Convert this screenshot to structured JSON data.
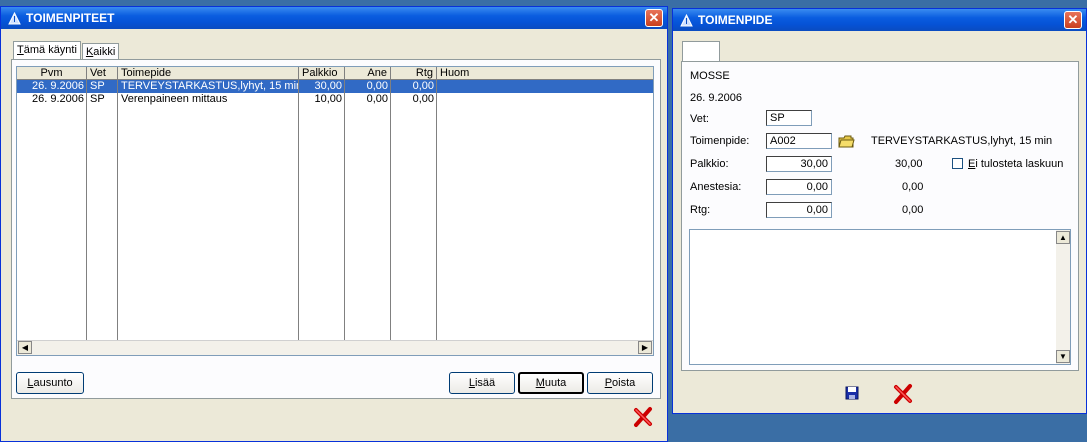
{
  "list_window": {
    "title": "TOIMENPITEET",
    "tabs": [
      {
        "accel": "T",
        "rest": "ämä käynti"
      },
      {
        "accel": "K",
        "rest": "aikki"
      }
    ],
    "columns": [
      "Pvm",
      "Vet",
      "Toimepide",
      "Palkkio",
      "Ane",
      "Rtg",
      "Huom"
    ],
    "rows": [
      {
        "pvm": "26. 9.2006",
        "vet": "SP",
        "toimepide": "TERVEYSTARKASTUS,lyhyt, 15 min",
        "palkkio": "30,00",
        "ane": "0,00",
        "rtg": "0,00",
        "huom": ""
      },
      {
        "pvm": "26. 9.2006",
        "vet": "SP",
        "toimepide": "Verenpaineen mittaus",
        "palkkio": "10,00",
        "ane": "0,00",
        "rtg": "0,00",
        "huom": ""
      }
    ],
    "buttons": {
      "lausunto": {
        "accel": "L",
        "rest": "ausunto"
      },
      "lisaa": {
        "accel": "L",
        "rest": "isää"
      },
      "muuta": {
        "accel": "M",
        "rest": "uuta"
      },
      "poista": {
        "accel": "P",
        "rest": "oista"
      }
    }
  },
  "detail_window": {
    "title": "TOIMENPIDE",
    "patient": "MOSSE",
    "date": "26. 9.2006",
    "vet_label": "Vet:",
    "vet_value": "SP",
    "toimenpide_label": "Toimenpide:",
    "toimenpide_code": "A002",
    "toimenpide_name": "TERVEYSTARKASTUS,lyhyt, 15 min",
    "palkkio_label": "Palkkio:",
    "palkkio_value": "30,00",
    "palkkio_readonly": "30,00",
    "checkbox": {
      "accel": "E",
      "rest": "i tulosteta laskuun",
      "checked": false
    },
    "anestesia_label": "Anestesia:",
    "anestesia_value": "0,00",
    "anestesia_readonly": "0,00",
    "rtg_label": "Rtg:",
    "rtg_value": "0,00",
    "rtg_readonly": "0,00",
    "notes": ""
  },
  "colors": {
    "title_blue": "#0552d6",
    "selection_blue": "#316ac5",
    "window_face": "#ece9d8",
    "cancel_red": "#cc0000"
  },
  "icons": [
    "app-icon",
    "close-icon",
    "folder-icon",
    "save-icon",
    "cancel-x-icon"
  ]
}
